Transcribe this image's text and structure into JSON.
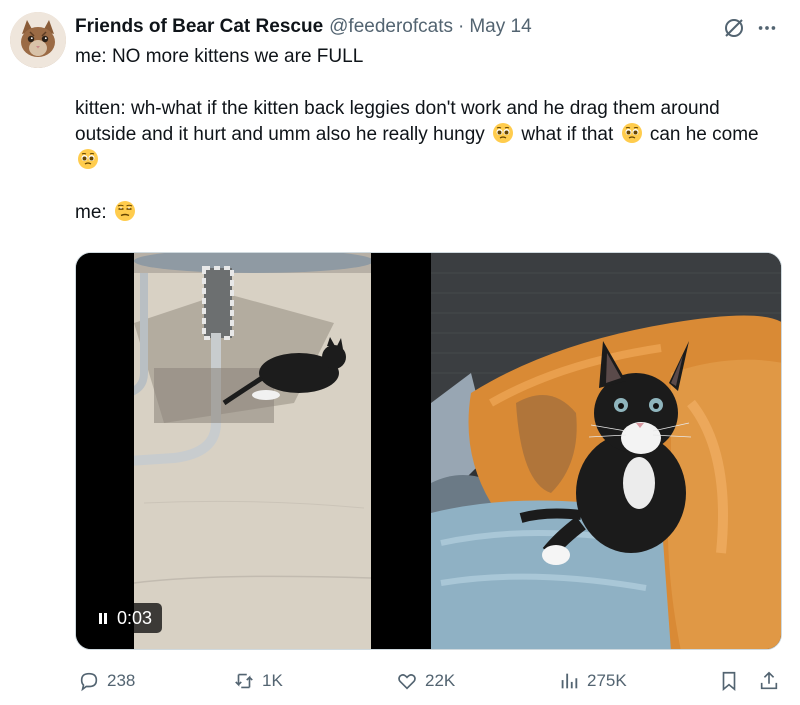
{
  "author": {
    "name": "Friends of Bear Cat Rescue",
    "handle": "@feederofcats",
    "separator": "·",
    "date": "May 14"
  },
  "tweet": {
    "line1": "me: NO more kittens we are FULL",
    "line2_part1": "kitten: wh-what if the kitten back leggies don't work and he drag them around outside and it hurt and umm also he really hungy",
    "line2_part2": "what if that",
    "line2_part3": "can he come",
    "line3": "me:"
  },
  "media": {
    "video_timer": "0:03"
  },
  "actions": {
    "replies": "238",
    "reposts": "1K",
    "likes": "22K",
    "views": "275K"
  },
  "icons": {
    "grok": "grok-icon",
    "more": "more-icon",
    "reply": "reply-icon",
    "repost": "repost-icon",
    "like": "heart-icon",
    "views": "views-icon",
    "bookmark": "bookmark-icon",
    "share": "share-icon",
    "emoji_pleading": "pleading-face-icon",
    "emoji_unamused": "unamused-face-icon"
  },
  "colors": {
    "text": "#0f1419",
    "secondary": "#536471",
    "border": "#cfd9de"
  }
}
